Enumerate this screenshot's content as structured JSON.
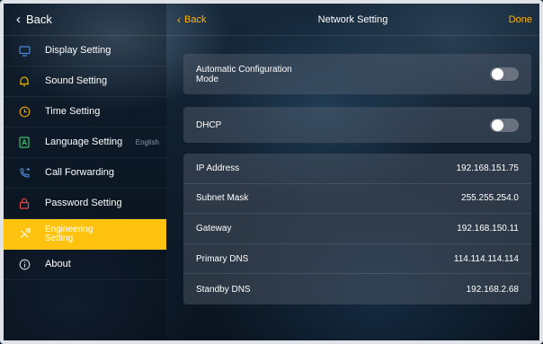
{
  "left": {
    "back_label": "Back",
    "items": [
      {
        "label": "Display Setting",
        "icon": "monitor-icon",
        "value": ""
      },
      {
        "label": "Sound Setting",
        "icon": "bell-icon",
        "value": ""
      },
      {
        "label": "Time Setting",
        "icon": "clock-icon",
        "value": ""
      },
      {
        "label": "Language Setting",
        "icon": "language-icon",
        "value": "English"
      },
      {
        "label": "Call Forwarding",
        "icon": "phone-forward-icon",
        "value": ""
      },
      {
        "label": "Password Setting",
        "icon": "lock-icon",
        "value": ""
      },
      {
        "label": "Engineering\nSetting",
        "icon": "tools-icon",
        "value": "",
        "active": true
      },
      {
        "label": "About",
        "icon": "info-icon",
        "value": ""
      }
    ]
  },
  "header": {
    "back_label": "Back",
    "title": "Network Setting",
    "done_label": "Done"
  },
  "toggles": [
    {
      "label": "Automatic Configuration\nMode",
      "on": false
    },
    {
      "label": "DHCP",
      "on": false
    }
  ],
  "network": [
    {
      "label": "IP Address",
      "value": "192.168.151.75"
    },
    {
      "label": "Subnet Mask",
      "value": "255.255.254.0"
    },
    {
      "label": "Gateway",
      "value": "192.168.150.11"
    },
    {
      "label": "Primary DNS",
      "value": "114.114.114.114"
    },
    {
      "label": "Standby DNS",
      "value": "192.168.2.68"
    }
  ],
  "colors": {
    "accent": "#ffc30f",
    "accent_text": "#ffb400"
  }
}
